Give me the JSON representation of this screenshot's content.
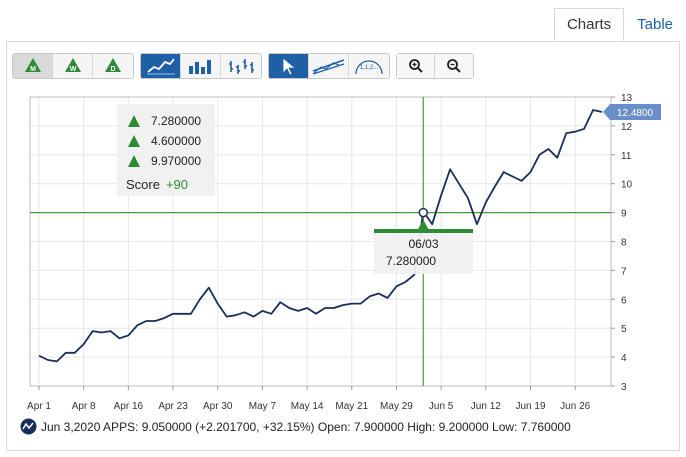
{
  "tabs": [
    {
      "label": "Charts"
    },
    {
      "label": "Table"
    }
  ],
  "toolbar": {
    "period_buttons": [
      "M",
      "W",
      "D"
    ],
    "chart_type_buttons": [
      "line-chart-icon",
      "bar-chart-icon",
      "ohlc-chart-icon"
    ],
    "tool_buttons": [
      "pointer-icon",
      "trendline-icon"
    ],
    "fibonacci_label": "1,1,2...",
    "zoom_buttons": [
      "zoom-in-icon",
      "zoom-out-icon"
    ]
  },
  "tooltip": {
    "monthly": "7.280000",
    "weekly": "4.600000",
    "daily": "9.970000",
    "score_label": "Score",
    "score_value": "+90"
  },
  "crosshair": {
    "date": "06/03",
    "value": "7.280000"
  },
  "last_price_label": "12.4800",
  "footer": {
    "text": "Jun 3,2020 APPS: 9.050000 (+2.201700, +32.15%) Open: 7.900000 High: 9.200000 Low: 7.760000"
  },
  "colors": {
    "line": "#1a2e5a",
    "crosshair": "#4a9a3a",
    "label_blue": "#6a8fc8",
    "green": "#2e8b35",
    "tab_link": "#1a5fa8"
  },
  "chart_data": {
    "type": "line",
    "ylim": [
      3,
      13
    ],
    "yticks": [
      3,
      4,
      5,
      6,
      7,
      8,
      9,
      10,
      11,
      12,
      13
    ],
    "xlim": [
      0,
      63
    ],
    "xticks": [
      {
        "i": 0,
        "label": "Apr 1"
      },
      {
        "i": 5,
        "label": "Apr 8"
      },
      {
        "i": 10,
        "label": "Apr 16"
      },
      {
        "i": 15,
        "label": "Apr 23"
      },
      {
        "i": 20,
        "label": "Apr 30"
      },
      {
        "i": 25,
        "label": "May 7"
      },
      {
        "i": 30,
        "label": "May 14"
      },
      {
        "i": 35,
        "label": "May 21"
      },
      {
        "i": 40,
        "label": "May 29"
      },
      {
        "i": 45,
        "label": "Jun 5"
      },
      {
        "i": 50,
        "label": "Jun 12"
      },
      {
        "i": 55,
        "label": "Jun 19"
      },
      {
        "i": 60,
        "label": "Jun 26"
      }
    ],
    "series": [
      {
        "values": [
          4.05,
          3.9,
          3.85,
          4.15,
          4.15,
          4.45,
          4.9,
          4.85,
          4.9,
          4.65,
          4.75,
          5.1,
          5.25,
          5.25,
          5.35,
          5.5,
          5.5,
          5.5,
          6.0,
          6.4,
          5.85,
          5.4,
          5.45,
          5.55,
          5.4,
          5.6,
          5.5,
          5.9,
          5.7,
          5.6,
          5.7,
          5.5,
          5.7,
          5.7,
          5.8,
          5.85,
          5.85,
          6.1,
          6.2,
          6.05,
          6.45,
          6.6,
          6.85,
          9.05,
          8.6,
          9.6,
          10.5,
          10.0,
          9.5,
          8.6,
          9.35,
          9.9,
          10.4,
          10.25,
          10.1,
          10.4,
          11.0,
          11.2,
          10.9,
          11.75,
          11.8,
          11.9,
          12.55,
          12.48
        ]
      }
    ],
    "crosshair": {
      "i": 43,
      "y": 9.0
    },
    "last_value": 12.48
  }
}
